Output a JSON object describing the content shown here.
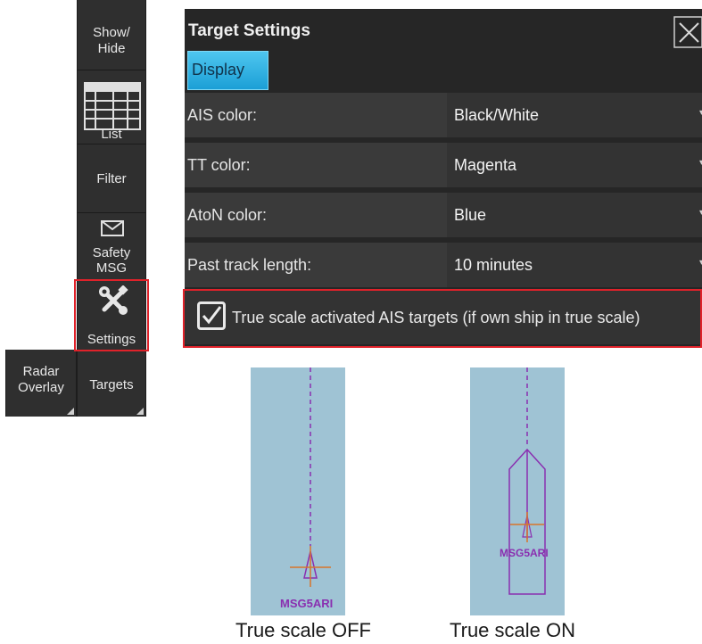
{
  "toolbar": {
    "show_hide": [
      "Show/",
      "Hide"
    ],
    "list": "List",
    "filter": "Filter",
    "safety": [
      "Safety",
      "MSG"
    ],
    "settings": "Settings",
    "radar_overlay": [
      "Radar",
      "Overlay"
    ],
    "targets": "Targets"
  },
  "dialog": {
    "title": "Target Settings",
    "tab": "Display",
    "rows": [
      {
        "label": "AIS color:",
        "value": "Black/White"
      },
      {
        "label": "TT color:",
        "value": "Magenta"
      },
      {
        "label": "AtoN color:",
        "value": "Blue"
      },
      {
        "label": "Past track length:",
        "value": "10 minutes"
      }
    ],
    "checkbox": {
      "label": "True scale activated AIS targets (if own ship in true scale)",
      "checked": true
    }
  },
  "examples": {
    "off": {
      "target_label": "MSG5ARI",
      "caption": "True scale OFF"
    },
    "on": {
      "target_label": "MSG5ARI",
      "caption": "True scale ON"
    }
  },
  "colors": {
    "highlight": "#e0222a",
    "tab_blue": "#1b9fd6",
    "sea": "#9fc3d4",
    "target_purple": "#8a2fb0",
    "cursor_orange": "#d8742a"
  }
}
